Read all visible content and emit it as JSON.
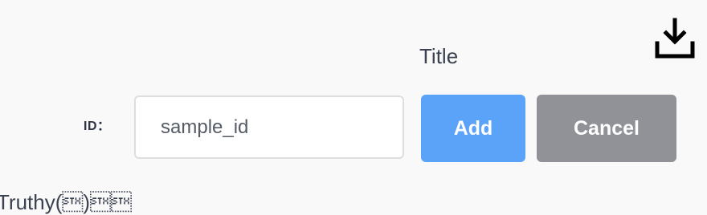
{
  "header": {
    "title": "Title",
    "download_icon": "download-icon"
  },
  "form": {
    "id_label": "ID：",
    "id_value": "sample_id"
  },
  "actions": {
    "add_label": "Add",
    "cancel_label": "Cancel"
  },
  "footer": {
    "text": "Truthy(\u0002)\u0002\u0002"
  },
  "colors": {
    "add_button": "#5aa3f8",
    "cancel_button": "#909298",
    "background": "#f9f9f9"
  }
}
